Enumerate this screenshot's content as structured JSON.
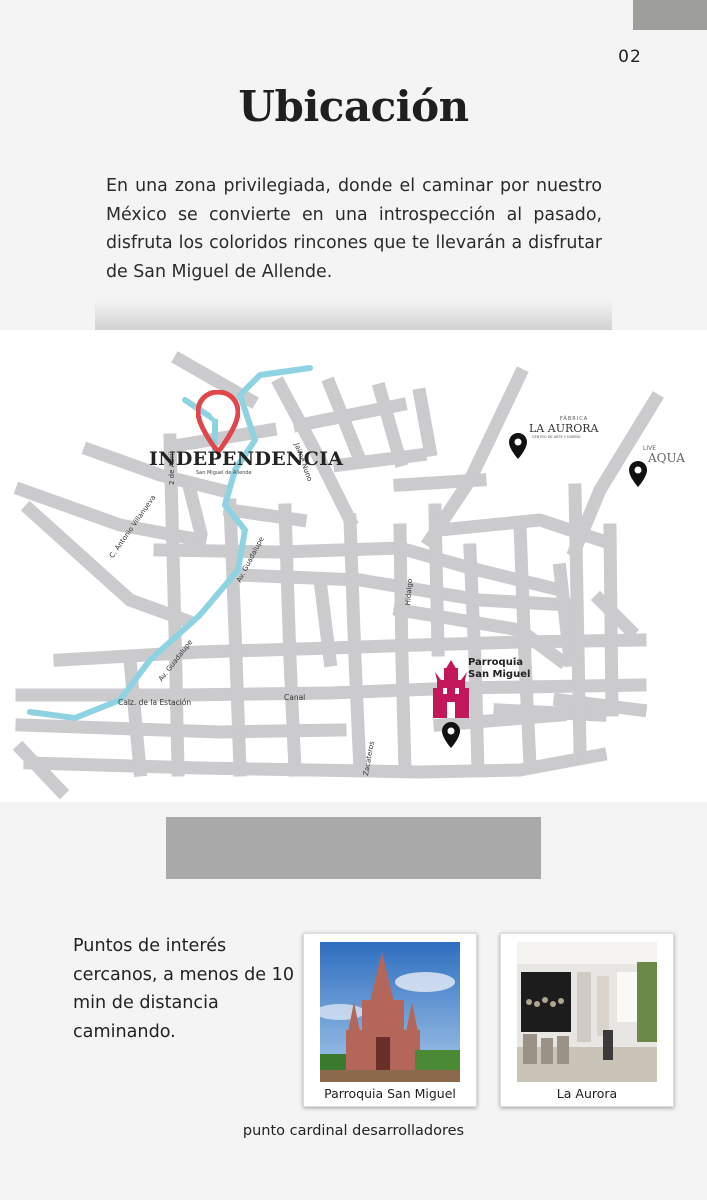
{
  "page_number": "02",
  "title": "Ubicación",
  "intro": "En una zona privilegiada, donde el caminar por nuestro México se convierte en una introspección al pasado, disfruta los coloridos rincones que te llevarán a disfrutar de San Miguel de Allende.",
  "map": {
    "brand_name": "INDEPENDENCIA",
    "brand_sub": "San Miguel de Allende",
    "aurora_top": "FÁBRICA",
    "aurora_name": "LA AURORA",
    "aurora_sub": "CENTRO DE ARTE Y DISEÑO",
    "live_top": "LIVE",
    "live_name": "AQUA",
    "parroquia_line1": "Parroquia",
    "parroquia_line2": "San Miguel",
    "streets": {
      "dos_de_abril": "2 de Abril",
      "villanueva": "C. Antonio Villanueva",
      "guadalupe_upper": "Av. Guadalupe",
      "guadalupe_lower": "Av. Guadalupe",
      "jaime_nuno": "Jaime Nuno",
      "hidalgo": "Hidalgo",
      "estacion": "Calz. de la Estación",
      "canal": "Canal",
      "zacateros": "Zacateros"
    },
    "colors": {
      "road": "#cbcbcd",
      "river": "#8fd3e2",
      "pin": "#e0474c",
      "church": "#c2185b"
    }
  },
  "poi_text": "Puntos de interés cercanos, a menos de 10 min de distancia caminando.",
  "cards": [
    {
      "caption": "Parroquia San Miguel"
    },
    {
      "caption": "La Aurora"
    }
  ],
  "footer": "punto cardinal desarrolladores"
}
